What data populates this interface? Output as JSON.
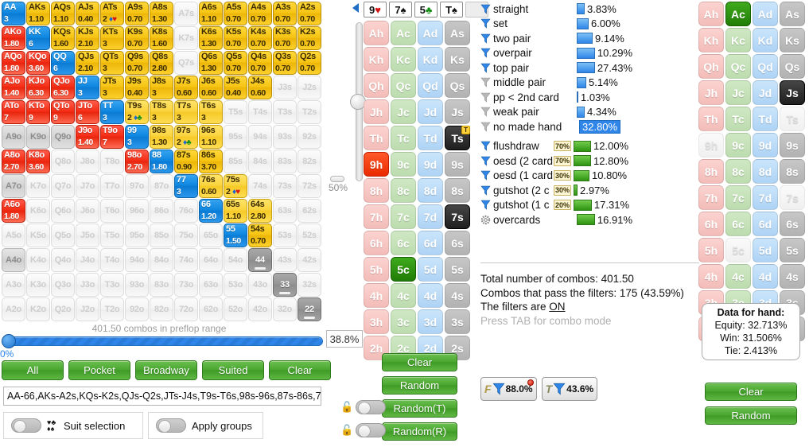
{
  "matrix": {
    "rows": [
      [
        {
          "l": "AA",
          "v": "3",
          "s": "blue"
        },
        {
          "l": "AKs",
          "v": "1.10",
          "s": "yellowdeep"
        },
        {
          "l": "AQs",
          "v": "1.10",
          "s": "yellowdeep"
        },
        {
          "l": "AJs",
          "v": "0.40",
          "s": "yellowdeep"
        },
        {
          "l": "ATs",
          "v": "2",
          "suits": "dh",
          "s": "yellowdeep"
        },
        {
          "l": "A9s",
          "v": "0.70",
          "s": "yellowdeep"
        },
        {
          "l": "A8s",
          "v": "1.30",
          "s": "yellowdeep"
        },
        {
          "l": "A7s",
          "v": "",
          "s": "empty"
        },
        {
          "l": "A6s",
          "v": "1.10",
          "s": "yellowdeep"
        },
        {
          "l": "A5s",
          "v": "0.70",
          "s": "yellowdeep"
        },
        {
          "l": "A4s",
          "v": "0.70",
          "s": "yellowdeep"
        },
        {
          "l": "A3s",
          "v": "0.70",
          "s": "yellowdeep"
        },
        {
          "l": "A2s",
          "v": "0.70",
          "s": "yellowdeep"
        }
      ],
      [
        {
          "l": "AKo",
          "v": "1.80",
          "s": "red"
        },
        {
          "l": "KK",
          "v": "6",
          "s": "blue"
        },
        {
          "l": "KQs",
          "v": "1.60",
          "s": "yellowdeep"
        },
        {
          "l": "KJs",
          "v": "2.10",
          "s": "yellowdeep"
        },
        {
          "l": "KTs",
          "v": "3",
          "s": "yellowdeep"
        },
        {
          "l": "K9s",
          "v": "0.70",
          "s": "yellowdeep"
        },
        {
          "l": "K8s",
          "v": "1.60",
          "s": "yellowdeep"
        },
        {
          "l": "K7s",
          "v": "",
          "s": "empty"
        },
        {
          "l": "K6s",
          "v": "1.30",
          "s": "yellowdeep"
        },
        {
          "l": "K5s",
          "v": "0.70",
          "s": "yellowdeep"
        },
        {
          "l": "K4s",
          "v": "0.70",
          "s": "yellowdeep"
        },
        {
          "l": "K3s",
          "v": "0.70",
          "s": "yellowdeep"
        },
        {
          "l": "K2s",
          "v": "0.70",
          "s": "yellowdeep"
        }
      ],
      [
        {
          "l": "AQo",
          "v": "1.80",
          "s": "red"
        },
        {
          "l": "KQo",
          "v": "3.60",
          "s": "red"
        },
        {
          "l": "QQ",
          "v": "6",
          "s": "blue"
        },
        {
          "l": "QJs",
          "v": "2.10",
          "s": "yellowdeep"
        },
        {
          "l": "QTs",
          "v": "3",
          "s": "yellowdeep"
        },
        {
          "l": "Q9s",
          "v": "0.70",
          "s": "yellowdeep"
        },
        {
          "l": "Q8s",
          "v": "2.80",
          "s": "yellowdeep"
        },
        {
          "l": "Q7s",
          "v": "",
          "s": "empty"
        },
        {
          "l": "Q6s",
          "v": "1.30",
          "s": "yellowdeep"
        },
        {
          "l": "Q5s",
          "v": "0.70",
          "s": "yellowdeep"
        },
        {
          "l": "Q4s",
          "v": "0.70",
          "s": "yellowdeep"
        },
        {
          "l": "Q3s",
          "v": "0.70",
          "s": "yellowdeep"
        },
        {
          "l": "Q2s",
          "v": "0.70",
          "s": "yellowdeep"
        }
      ],
      [
        {
          "l": "AJo",
          "v": "1.40",
          "s": "red"
        },
        {
          "l": "KJo",
          "v": "6.30",
          "s": "red"
        },
        {
          "l": "QJo",
          "v": "6.30",
          "s": "red"
        },
        {
          "l": "JJ",
          "v": "3",
          "s": "blue"
        },
        {
          "l": "JTs",
          "v": "3",
          "s": "yellowdeep"
        },
        {
          "l": "J9s",
          "v": "0.40",
          "s": "yellowdeep"
        },
        {
          "l": "J8s",
          "v": "3",
          "s": "yellowdeep"
        },
        {
          "l": "J7s",
          "v": "0.60",
          "s": "yellowdeep"
        },
        {
          "l": "J6s",
          "v": "0.60",
          "s": "yellowdeep"
        },
        {
          "l": "J5s",
          "v": "0.40",
          "s": "yellowdeep"
        },
        {
          "l": "J4s",
          "v": "0.60",
          "s": "yellowdeep"
        },
        {
          "l": "J3s",
          "v": "",
          "s": "empty"
        },
        {
          "l": "J2s",
          "v": "",
          "s": "empty"
        }
      ],
      [
        {
          "l": "ATo",
          "v": "7",
          "s": "red"
        },
        {
          "l": "KTo",
          "v": "9",
          "s": "red"
        },
        {
          "l": "QTo",
          "v": "9",
          "s": "red"
        },
        {
          "l": "JTo",
          "v": "6",
          "s": "red"
        },
        {
          "l": "TT",
          "v": "3",
          "s": "blue"
        },
        {
          "l": "T9s",
          "v": "2",
          "suits": "dc",
          "s": "yellow"
        },
        {
          "l": "T8s",
          "v": "3",
          "s": "yellow"
        },
        {
          "l": "T7s",
          "v": "3",
          "s": "yellow"
        },
        {
          "l": "T6s",
          "v": "3",
          "s": "yellow"
        },
        {
          "l": "T5s",
          "v": "",
          "s": "empty"
        },
        {
          "l": "T4s",
          "v": "",
          "s": "empty"
        },
        {
          "l": "T3s",
          "v": "",
          "s": "empty"
        },
        {
          "l": "T2s",
          "v": "",
          "s": "empty"
        }
      ],
      [
        {
          "l": "A9o",
          "v": "",
          "s": "gray"
        },
        {
          "l": "K9o",
          "v": "",
          "s": "gray"
        },
        {
          "l": "Q9o",
          "v": "",
          "s": "gray"
        },
        {
          "l": "J9o",
          "v": "1.40",
          "s": "red"
        },
        {
          "l": "T9o",
          "v": "7",
          "s": "red"
        },
        {
          "l": "99",
          "v": "3",
          "s": "blue"
        },
        {
          "l": "98s",
          "v": "1.30",
          "s": "yellow"
        },
        {
          "l": "97s",
          "v": "2",
          "suits": "dc",
          "s": "yellow"
        },
        {
          "l": "96s",
          "v": "1.10",
          "s": "yellow"
        },
        {
          "l": "95s",
          "v": "",
          "s": "empty"
        },
        {
          "l": "94s",
          "v": "",
          "s": "empty"
        },
        {
          "l": "93s",
          "v": "",
          "s": "empty"
        },
        {
          "l": "92s",
          "v": "",
          "s": "empty"
        }
      ],
      [
        {
          "l": "A8o",
          "v": "2.70",
          "s": "red"
        },
        {
          "l": "K8o",
          "v": "3.60",
          "s": "red"
        },
        {
          "l": "Q8o",
          "v": "",
          "s": "empty"
        },
        {
          "l": "J8o",
          "v": "",
          "s": "empty"
        },
        {
          "l": "T8o",
          "v": "",
          "s": "empty"
        },
        {
          "l": "98o",
          "v": "2.70",
          "s": "red"
        },
        {
          "l": "88",
          "v": "1.80",
          "s": "blue"
        },
        {
          "l": "87s",
          "v": "0.90",
          "s": "yellowdeep"
        },
        {
          "l": "86s",
          "v": "3.70",
          "s": "yellowdeep"
        },
        {
          "l": "85s",
          "v": "",
          "s": "empty"
        },
        {
          "l": "84s",
          "v": "",
          "s": "empty"
        },
        {
          "l": "83s",
          "v": "",
          "s": "empty"
        },
        {
          "l": "82s",
          "v": "",
          "s": "empty"
        }
      ],
      [
        {
          "l": "A7o",
          "v": "",
          "s": "gray"
        },
        {
          "l": "K7o",
          "v": "",
          "s": "empty"
        },
        {
          "l": "Q7o",
          "v": "",
          "s": "empty"
        },
        {
          "l": "J7o",
          "v": "",
          "s": "empty"
        },
        {
          "l": "T7o",
          "v": "",
          "s": "empty"
        },
        {
          "l": "97o",
          "v": "",
          "s": "empty"
        },
        {
          "l": "87o",
          "v": "",
          "s": "empty"
        },
        {
          "l": "77",
          "v": "3",
          "s": "blue"
        },
        {
          "l": "76s",
          "v": "0.60",
          "s": "yellow"
        },
        {
          "l": "75s",
          "v": "2",
          "suits": "dh",
          "s": "yellow"
        },
        {
          "l": "74s",
          "v": "",
          "s": "empty"
        },
        {
          "l": "73s",
          "v": "",
          "s": "empty"
        },
        {
          "l": "72s",
          "v": "",
          "s": "empty"
        }
      ],
      [
        {
          "l": "A6o",
          "v": "1.80",
          "s": "red"
        },
        {
          "l": "K6o",
          "v": "",
          "s": "empty"
        },
        {
          "l": "Q6o",
          "v": "",
          "s": "empty"
        },
        {
          "l": "J6o",
          "v": "",
          "s": "empty"
        },
        {
          "l": "T6o",
          "v": "",
          "s": "empty"
        },
        {
          "l": "96o",
          "v": "",
          "s": "empty"
        },
        {
          "l": "86o",
          "v": "",
          "s": "empty"
        },
        {
          "l": "76o",
          "v": "",
          "s": "empty"
        },
        {
          "l": "66",
          "v": "1.20",
          "s": "blue"
        },
        {
          "l": "65s",
          "v": "1.10",
          "s": "yellow"
        },
        {
          "l": "64s",
          "v": "2.80",
          "s": "yellow"
        },
        {
          "l": "63s",
          "v": "",
          "s": "empty"
        },
        {
          "l": "62s",
          "v": "",
          "s": "empty"
        }
      ],
      [
        {
          "l": "A5o",
          "v": "",
          "s": "empty"
        },
        {
          "l": "K5o",
          "v": "",
          "s": "empty"
        },
        {
          "l": "Q5o",
          "v": "",
          "s": "empty"
        },
        {
          "l": "J5o",
          "v": "",
          "s": "empty"
        },
        {
          "l": "T5o",
          "v": "",
          "s": "empty"
        },
        {
          "l": "95o",
          "v": "",
          "s": "empty"
        },
        {
          "l": "85o",
          "v": "",
          "s": "empty"
        },
        {
          "l": "75o",
          "v": "",
          "s": "empty"
        },
        {
          "l": "65o",
          "v": "",
          "s": "empty"
        },
        {
          "l": "55",
          "v": "1.50",
          "s": "blue"
        },
        {
          "l": "54s",
          "v": "0.70",
          "s": "yellowdeep"
        },
        {
          "l": "53s",
          "v": "",
          "s": "empty"
        },
        {
          "l": "52s",
          "v": "",
          "s": "empty"
        }
      ],
      [
        {
          "l": "A4o",
          "v": "",
          "s": "gray"
        },
        {
          "l": "K4o",
          "v": "",
          "s": "empty"
        },
        {
          "l": "Q4o",
          "v": "",
          "s": "empty"
        },
        {
          "l": "J4o",
          "v": "",
          "s": "empty"
        },
        {
          "l": "T4o",
          "v": "",
          "s": "empty"
        },
        {
          "l": "94o",
          "v": "",
          "s": "empty"
        },
        {
          "l": "84o",
          "v": "",
          "s": "empty"
        },
        {
          "l": "74o",
          "v": "",
          "s": "empty"
        },
        {
          "l": "64o",
          "v": "",
          "s": "empty"
        },
        {
          "l": "54o",
          "v": "",
          "s": "empty"
        },
        {
          "l": "44",
          "v": "",
          "s": "dark",
          "dash": true
        },
        {
          "l": "43s",
          "v": "",
          "s": "empty"
        },
        {
          "l": "42s",
          "v": "",
          "s": "empty"
        }
      ],
      [
        {
          "l": "A3o",
          "v": "",
          "s": "empty"
        },
        {
          "l": "K3o",
          "v": "",
          "s": "empty"
        },
        {
          "l": "Q3o",
          "v": "",
          "s": "empty"
        },
        {
          "l": "J3o",
          "v": "",
          "s": "empty"
        },
        {
          "l": "T3o",
          "v": "",
          "s": "empty"
        },
        {
          "l": "93o",
          "v": "",
          "s": "empty"
        },
        {
          "l": "83o",
          "v": "",
          "s": "empty"
        },
        {
          "l": "73o",
          "v": "",
          "s": "empty"
        },
        {
          "l": "63o",
          "v": "",
          "s": "empty"
        },
        {
          "l": "53o",
          "v": "",
          "s": "empty"
        },
        {
          "l": "43o",
          "v": "",
          "s": "empty"
        },
        {
          "l": "33",
          "v": "",
          "s": "dark",
          "dash": true
        },
        {
          "l": "32s",
          "v": "",
          "s": "empty"
        }
      ],
      [
        {
          "l": "A2o",
          "v": "",
          "s": "empty"
        },
        {
          "l": "K2o",
          "v": "",
          "s": "empty"
        },
        {
          "l": "Q2o",
          "v": "",
          "s": "empty"
        },
        {
          "l": "J2o",
          "v": "",
          "s": "empty"
        },
        {
          "l": "T2o",
          "v": "",
          "s": "empty"
        },
        {
          "l": "92o",
          "v": "",
          "s": "empty"
        },
        {
          "l": "82o",
          "v": "",
          "s": "empty"
        },
        {
          "l": "72o",
          "v": "",
          "s": "empty"
        },
        {
          "l": "62o",
          "v": "",
          "s": "empty"
        },
        {
          "l": "52o",
          "v": "",
          "s": "empty"
        },
        {
          "l": "42o",
          "v": "",
          "s": "empty"
        },
        {
          "l": "32o",
          "v": "",
          "s": "empty"
        },
        {
          "l": "22",
          "v": "",
          "s": "dark",
          "dash": true
        }
      ]
    ]
  },
  "preflop": {
    "combos_label": "401.50 combos in preflop range",
    "min_label": "0%",
    "percent_value": "38.8%"
  },
  "range_buttons": [
    "All",
    "Pocket",
    "Broadway",
    "Suited",
    "Clear"
  ],
  "range_text": "AA-66,AKs-A2s,KQs-K2s,QJs-Q2s,JTs-J4s,T9s-T6s,98s-96s,87s-86s,7",
  "toggles": {
    "suit_selection": "Suit selection",
    "apply_groups": "Apply groups"
  },
  "vslider": {
    "percent": "50%"
  },
  "board": {
    "cards": [
      {
        "rank": "9",
        "suit": "♥",
        "color": "#d81515"
      },
      {
        "rank": "7",
        "suit": "♠",
        "color": "#111111"
      },
      {
        "rank": "5",
        "suit": "♣",
        "color": "#159015"
      },
      {
        "rank": "T",
        "suit": "♠",
        "color": "#111111"
      }
    ],
    "empty_slot": ""
  },
  "mid_grid": {
    "ranks": [
      "A",
      "K",
      "Q",
      "J",
      "T",
      "9",
      "8",
      "7",
      "6",
      "5",
      "4",
      "3",
      "2"
    ],
    "states": {
      "Ts": "sel-black-T",
      "9h": "sel-red",
      "7s": "sel-black",
      "5c": "sel-green",
      "Ac": "",
      "Js": ""
    }
  },
  "right_grid": {
    "states": {
      "Ac": "sel-green",
      "Js": "sel-black",
      "Ts": "faded",
      "9h": "faded",
      "7s": "faded",
      "5c": "faded"
    }
  },
  "filters": {
    "made": [
      {
        "name": "straight",
        "pct": "3.83%",
        "bar": 10,
        "active": true,
        "hl": false
      },
      {
        "name": "set",
        "pct": "6.00%",
        "bar": 15,
        "active": true,
        "hl": false
      },
      {
        "name": "two pair",
        "pct": "9.14%",
        "bar": 20,
        "active": true,
        "hl": false
      },
      {
        "name": "overpair",
        "pct": "10.29%",
        "bar": 25,
        "active": true,
        "hl": false
      },
      {
        "name": "top pair",
        "pct": "27.43%",
        "bar": 62,
        "active": true,
        "hl": false
      },
      {
        "name": "middle pair",
        "pct": "5.14%",
        "bar": 12,
        "active": false,
        "hl": false
      },
      {
        "name": "pp < 2nd card",
        "pct": "1.03%",
        "bar": 2,
        "active": false,
        "hl": false
      },
      {
        "name": "weak pair",
        "pct": "4.34%",
        "bar": 10,
        "active": false,
        "hl": false
      },
      {
        "name": "no made hand",
        "pct": "32.80%",
        "bar": 0,
        "active": false,
        "hl": true
      }
    ],
    "draws": [
      {
        "name": "flushdraw",
        "weight": "70%",
        "pct": "12.00%",
        "bar": 22,
        "active": true
      },
      {
        "name": "oesd (2 card",
        "weight": "70%",
        "pct": "12.80%",
        "bar": 22,
        "active": true
      },
      {
        "name": "oesd (1 card",
        "weight": "30%",
        "pct": "10.80%",
        "bar": 20,
        "active": true
      },
      {
        "name": "gutshot (2 c",
        "weight": "30%",
        "pct": "2.97%",
        "bar": 5,
        "active": true
      },
      {
        "name": "gutshot (1 c",
        "weight": "20%",
        "pct": "17.31%",
        "bar": 36,
        "active": true
      },
      {
        "name": "overcards",
        "weight": "",
        "pct": "16.91%",
        "bar": 33,
        "active": false,
        "gear": true
      }
    ]
  },
  "stats": {
    "total": "Total number of combos: 401.50",
    "passed": "Combos that pass the filters: 175 (43.59%)",
    "filters_prefix": "The filters are ",
    "filters_state": "ON",
    "hint": "Press TAB for combo mode"
  },
  "equity_badges": [
    {
      "prefix": "F",
      "value": "88.0%",
      "dot": true
    },
    {
      "prefix": "T",
      "value": "43.6%",
      "dot": false
    }
  ],
  "mid_buttons": [
    "Clear",
    "Random",
    "Random(T)",
    "Random(R)"
  ],
  "data_panel": {
    "title": "Data for hand:",
    "equity": "Equity: 32.713%",
    "win": "Win: 31.506%",
    "tie": "Tie: 2.413%"
  },
  "right_buttons": [
    "Clear",
    "Random"
  ]
}
